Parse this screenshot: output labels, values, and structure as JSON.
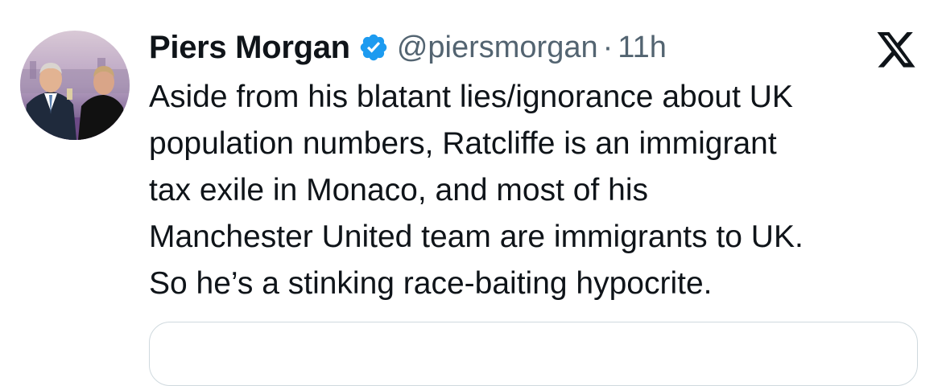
{
  "tweet": {
    "author": {
      "display_name": "Piers Morgan",
      "verified": true,
      "handle": "@piersmorgan",
      "separator": "·",
      "time": "11h"
    },
    "body_lines": [
      "Aside from his blatant lies/ignorance about UK",
      "population numbers, Ratcliffe is an immigrant",
      "tax exile in Monaco, and most of his",
      "Manchester United team are immigrants to UK.",
      "So he’s a stinking race-baiting hypocrite."
    ]
  },
  "icons": {
    "verified": "verified-badge-icon",
    "platform": "x-logo-icon"
  },
  "colors": {
    "verified_blue": "#1d9bf0",
    "text_primary": "#0f1419",
    "text_secondary": "#536471",
    "border": "#cfd9de"
  }
}
